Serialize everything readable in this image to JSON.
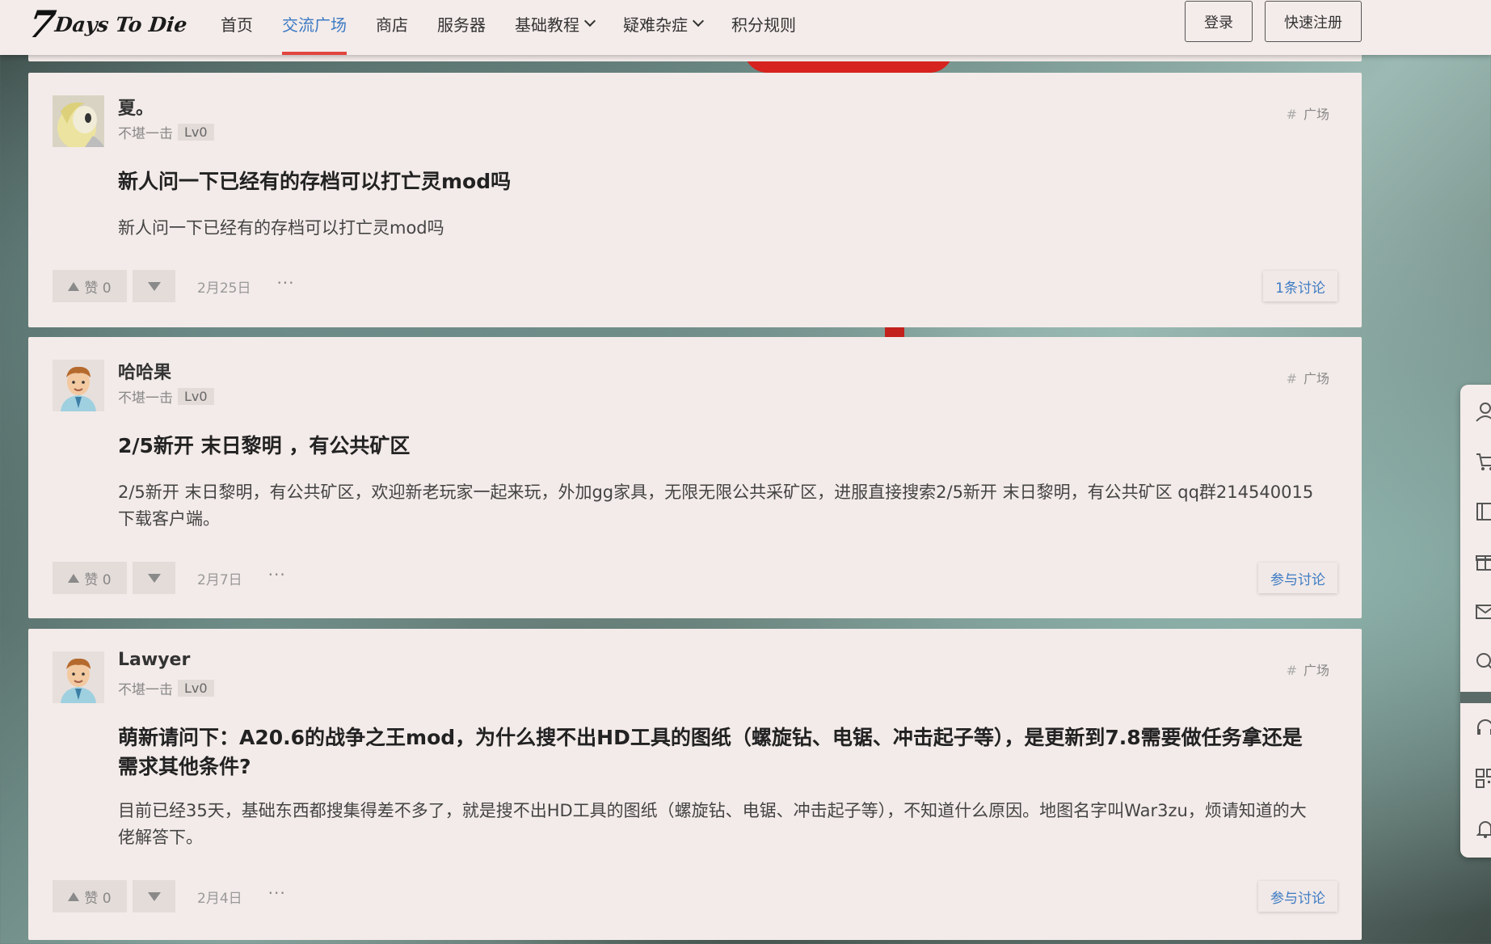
{
  "header": {
    "logo": {
      "seven": "7",
      "rest": "Days To Die"
    },
    "nav": [
      {
        "label": "首页",
        "active": false,
        "dropdown": false
      },
      {
        "label": "交流广场",
        "active": true,
        "dropdown": false
      },
      {
        "label": "商店",
        "active": false,
        "dropdown": false
      },
      {
        "label": "服务器",
        "active": false,
        "dropdown": false
      },
      {
        "label": "基础教程",
        "active": false,
        "dropdown": true
      },
      {
        "label": "疑难杂症",
        "active": false,
        "dropdown": true
      },
      {
        "label": "积分规则",
        "active": false,
        "dropdown": false
      }
    ],
    "login_label": "登录",
    "register_label": "快速注册"
  },
  "posts": [
    {
      "username": "夏。",
      "rank": "不堪一击",
      "level": "Lv0",
      "tag": "广场",
      "title": "新人问一下已经有的存档可以打亡灵mod吗",
      "body": "新人问一下已经有的存档可以打亡灵mod吗",
      "likes_label": "赞 0",
      "date": "2月25日",
      "more": "···",
      "discuss_label": "1条讨论"
    },
    {
      "username": "哈哈果",
      "rank": "不堪一击",
      "level": "Lv0",
      "tag": "广场",
      "title": "2/5新开 末日黎明 ，有公共矿区",
      "body": "2/5新开 末日黎明，有公共矿区，欢迎新老玩家一起来玩，外加gg家具，无限无限公共采矿区，进服直接搜索2/5新开 末日黎明，有公共矿区 qq群214540015下载客户端。",
      "likes_label": "赞 0",
      "date": "2月7日",
      "more": "···",
      "discuss_label": "参与讨论"
    },
    {
      "username": "Lawyer",
      "rank": "不堪一击",
      "level": "Lv0",
      "tag": "广场",
      "title": "萌新请问下：A20.6的战争之王mod，为什么搜不出HD工具的图纸（螺旋钻、电锯、冲击起子等），是更新到7.8需要做任务拿还是需求其他条件?",
      "body": "目前已经35天，基础东西都搜集得差不多了，就是搜不出HD工具的图纸（螺旋钻、电锯、冲击起子等），不知道什么原因。地图名字叫War3zu，烦请知道的大佬解答下。",
      "likes_label": "赞 0",
      "date": "2月4日",
      "more": "···",
      "discuss_label": "参与讨论"
    }
  ],
  "right_toolbar": {
    "icons": [
      "user-icon",
      "cart-icon",
      "book-icon",
      "gift-icon",
      "mail-icon",
      "search-icon",
      "headset-icon",
      "qrcode-icon",
      "bell-icon"
    ]
  },
  "colors": {
    "accent": "#3d7bc4",
    "nav_underline": "#e1453f",
    "card_bg": "#f3ebe9"
  }
}
